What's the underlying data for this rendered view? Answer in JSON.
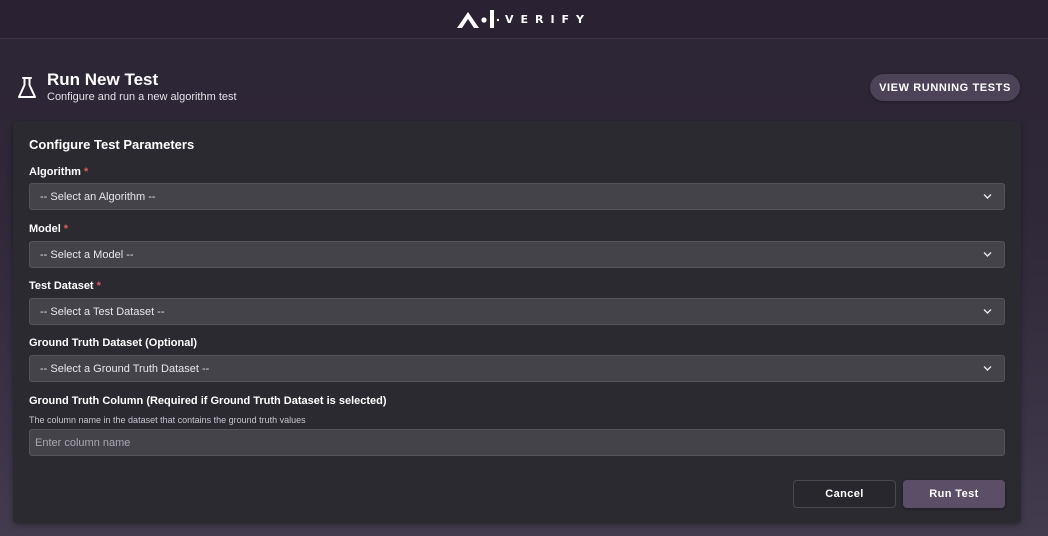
{
  "brand": {
    "logo_text": "VERIFY",
    "logo_icon": "ai-verify-mark-icon"
  },
  "header": {
    "icon": "flask-icon",
    "title": "Run New Test",
    "subtitle": "Configure and run a new algorithm test",
    "view_running_label": "VIEW RUNNING TESTS"
  },
  "form": {
    "title": "Configure Test Parameters",
    "required_marker": "*",
    "algorithm": {
      "label": "Algorithm",
      "selected": "-- Select an Algorithm --"
    },
    "model": {
      "label": "Model",
      "selected": "-- Select a Model --"
    },
    "test_dataset": {
      "label": "Test Dataset",
      "selected": "-- Select a Test Dataset --"
    },
    "ground_truth_dataset": {
      "label": "Ground Truth Dataset (Optional)",
      "selected": "-- Select a Ground Truth Dataset --"
    },
    "ground_truth_column": {
      "label": "Ground Truth Column (Required if Ground Truth Dataset is selected)",
      "help": "The column name in the dataset that contains the ground truth values",
      "value": "",
      "placeholder": "Enter column name"
    },
    "cancel_label": "Cancel",
    "run_label": "Run Test"
  },
  "colors": {
    "accent": "#5b4f68",
    "required": "#e05a5a",
    "card": "#2b2a31",
    "field": "#44434a"
  }
}
